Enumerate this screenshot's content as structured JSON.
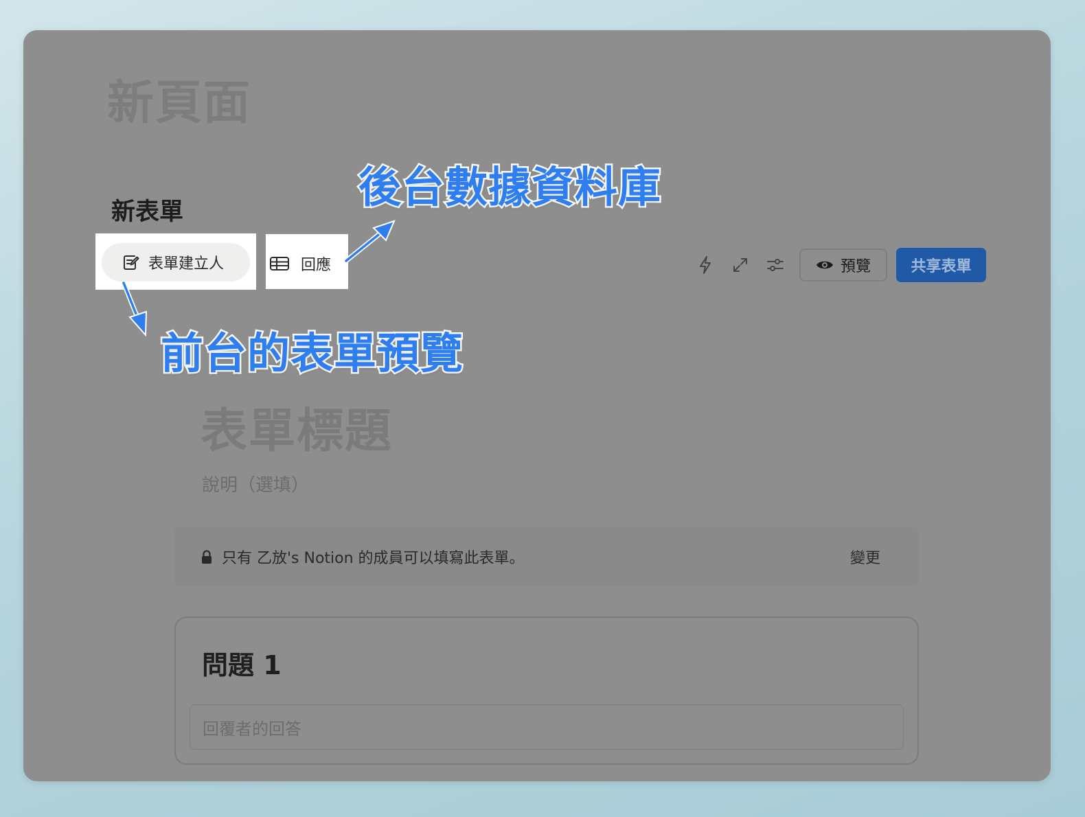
{
  "page": {
    "title": "新頁面"
  },
  "form": {
    "name": "新表單",
    "tabs": [
      {
        "label": "表單建立人",
        "icon": "edit-form-icon"
      },
      {
        "label": "回應",
        "icon": "table-icon"
      }
    ],
    "toolbar": {
      "icons": [
        "lightning-icon",
        "expand-icon",
        "settings-sliders-icon"
      ],
      "preview_label": "預覽",
      "share_label": "共享表單"
    },
    "title": "表單標題",
    "description_placeholder": "說明（選填）",
    "access_notice": "只有 乙放's Notion 的成員可以填寫此表單。",
    "change_label": "變更",
    "questions": [
      {
        "label": "問題 1",
        "answer_placeholder": "回覆者的回答"
      }
    ]
  },
  "annotations": {
    "backend": "後台數據資料庫",
    "frontend": "前台的表單預覽"
  },
  "colors": {
    "annotation_blue": "#2f7ef0",
    "share_button": "#205aa6",
    "overlay_gray": "#8e8e8e"
  }
}
